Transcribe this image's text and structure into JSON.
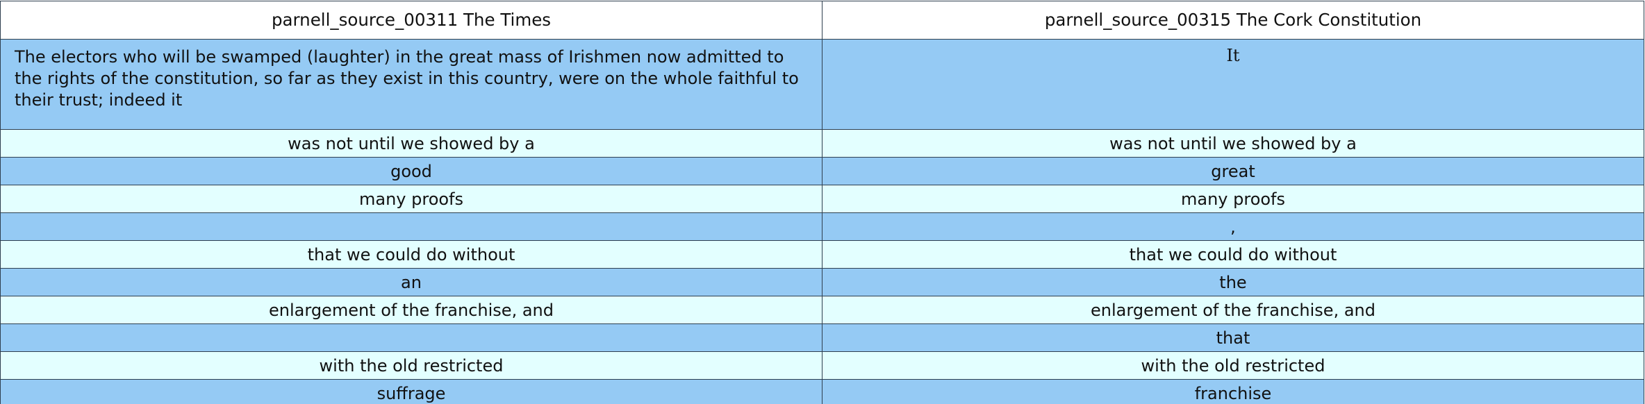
{
  "table": {
    "header": {
      "left": "parnell_source_00311 The Times",
      "right": "parnell_source_00315 The Cork Constitution"
    },
    "first_row": {
      "left": "The electors who will be swamped (laughter) in the great mass of Irishmen now admitted to the rights of the constitution, so far as they exist in this country, were on the whole faithful to their trust; indeed it",
      "right": "It"
    },
    "rows": [
      {
        "left": "was not until we showed by a",
        "right": "was not until we showed by a"
      },
      {
        "left": "good",
        "right": "great"
      },
      {
        "left": "many proofs",
        "right": "many proofs"
      },
      {
        "left": "",
        "right": ","
      },
      {
        "left": "that we could do without",
        "right": "that we could do without"
      },
      {
        "left": "an",
        "right": "the"
      },
      {
        "left": "enlargement of the franchise, and",
        "right": "enlargement of the franchise, and"
      },
      {
        "left": "",
        "right": "that"
      },
      {
        "left": "with the old restricted",
        "right": "with the old restricted"
      },
      {
        "left": "suffrage",
        "right": "franchise"
      }
    ]
  },
  "colors": {
    "light_row": "#e3ffff",
    "dark_row": "#95caf4",
    "border": "#2f3f4f"
  }
}
